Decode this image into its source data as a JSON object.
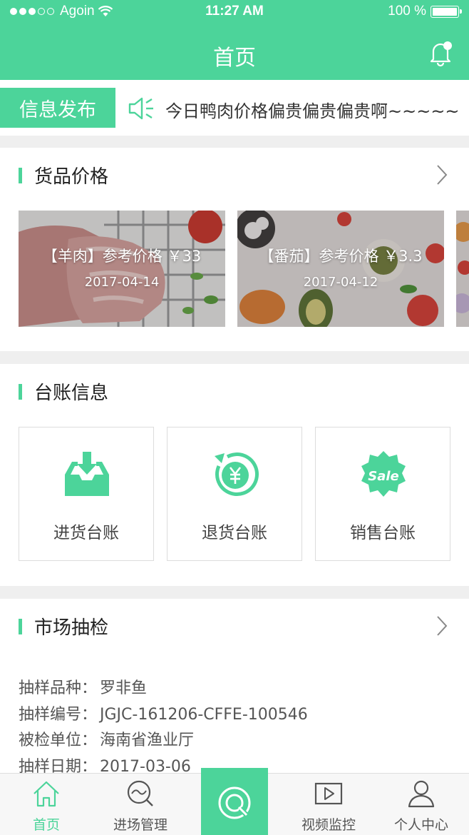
{
  "status_bar": {
    "carrier": "Agoin",
    "time": "11:27 AM",
    "battery": "100 %"
  },
  "nav": {
    "title": "首页"
  },
  "ticker": {
    "label": "信息发布",
    "text": "今日鸭肉价格偏贵偏贵偏贵啊~~~~~"
  },
  "goods": {
    "title": "货品价格",
    "items": [
      {
        "title": "【羊肉】参考价格 ￥33",
        "date": "2017-04-14"
      },
      {
        "title": "【番茄】参考价格 ￥3.3",
        "date": "2017-04-12"
      }
    ]
  },
  "ledger": {
    "title": "台账信息",
    "items": [
      {
        "label": "进货台账",
        "icon": "inbox-download-icon"
      },
      {
        "label": "退货台账",
        "icon": "yuan-return-icon"
      },
      {
        "label": "销售台账",
        "icon": "sale-badge-icon"
      }
    ]
  },
  "inspection": {
    "title": "市场抽检",
    "rows": [
      {
        "key": "抽样品种：",
        "value": "罗非鱼"
      },
      {
        "key": "抽样编号：",
        "value": "JGJC-161206-CFFE-100546"
      },
      {
        "key": "被检单位：",
        "value": "海南省渔业厅"
      },
      {
        "key": "抽样日期：",
        "value": "2017-03-06"
      }
    ]
  },
  "tabbar": {
    "items": [
      {
        "label": "首页",
        "icon": "home-icon"
      },
      {
        "label": "进场管理",
        "icon": "entry-search-icon"
      },
      {
        "label": "",
        "icon": "scan-center-icon"
      },
      {
        "label": "视频监控",
        "icon": "video-play-icon"
      },
      {
        "label": "个人中心",
        "icon": "user-icon"
      }
    ]
  },
  "colors": {
    "accent": "#4cd49a"
  }
}
